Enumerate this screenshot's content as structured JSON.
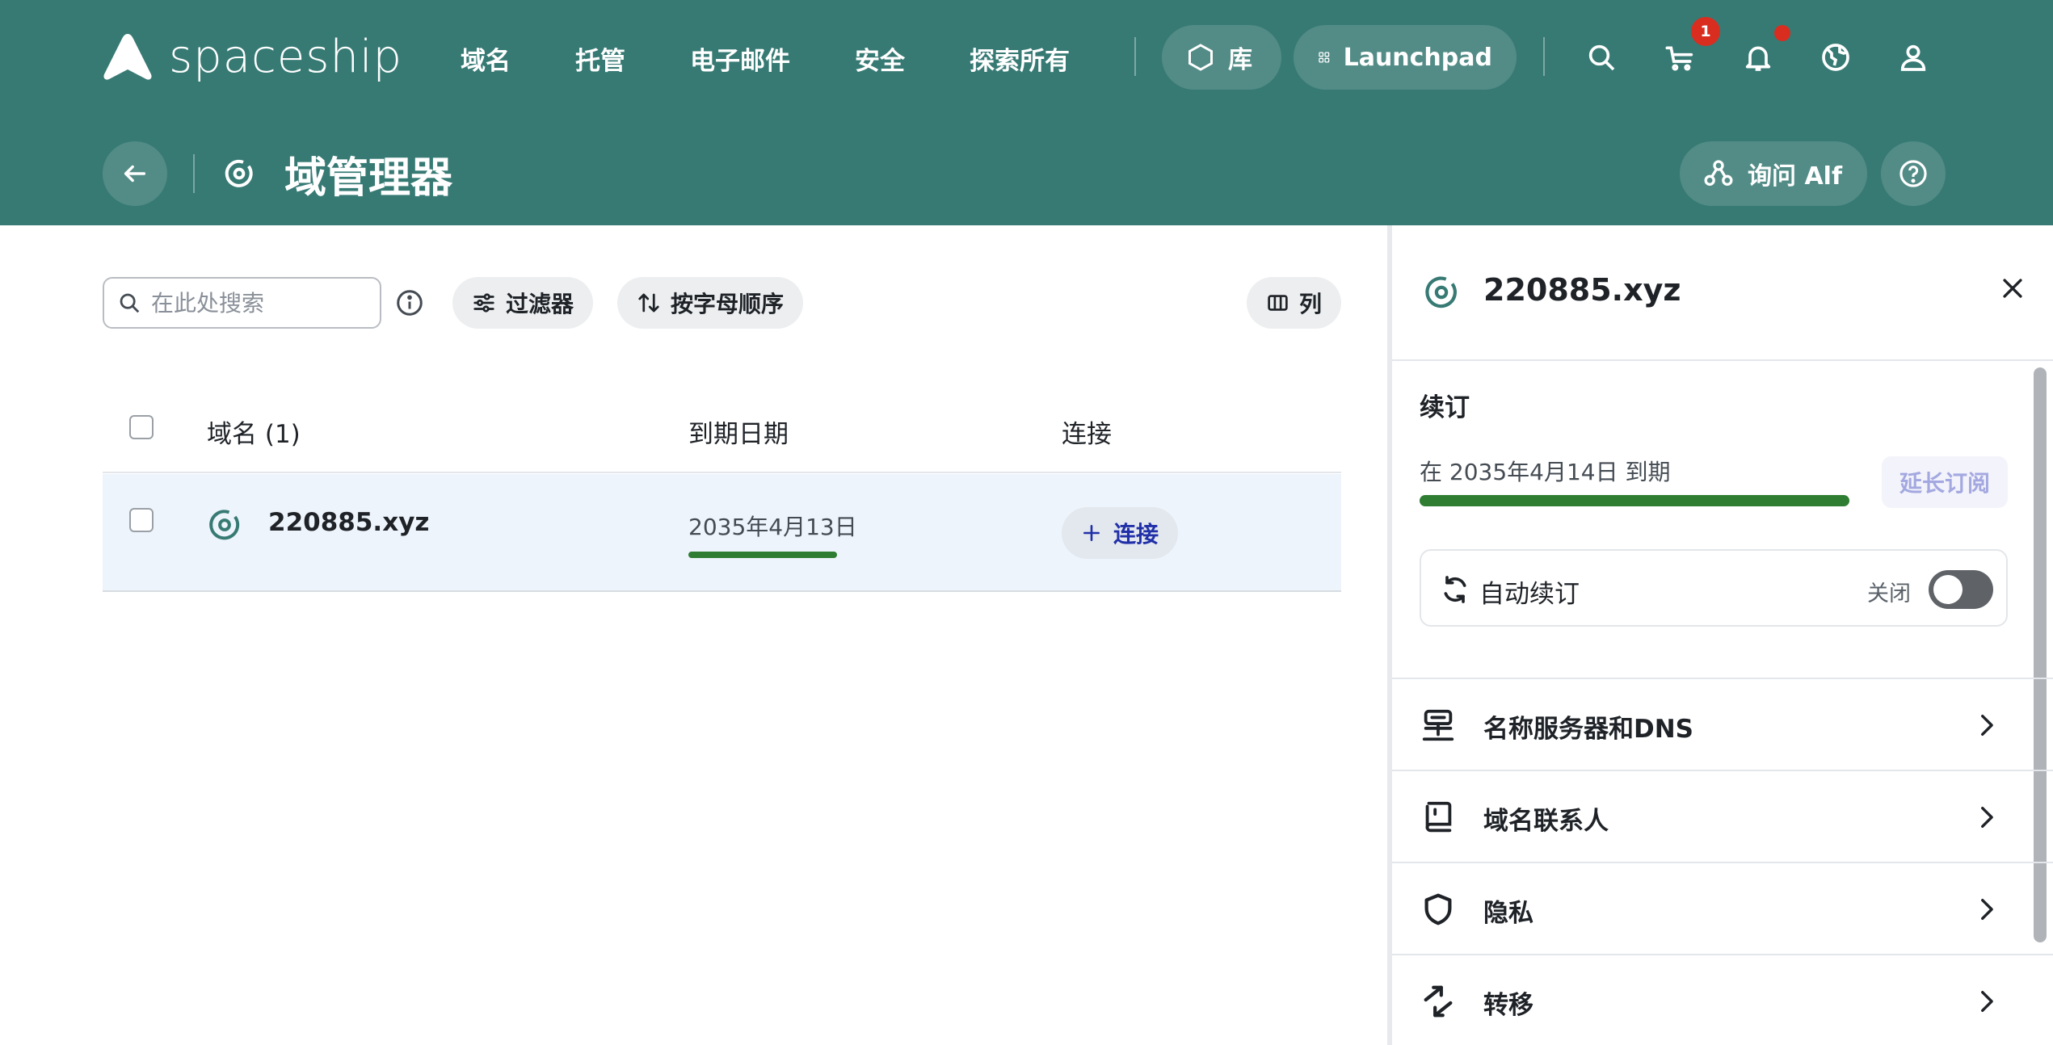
{
  "header": {
    "brand": "spaceship",
    "nav": [
      "域名",
      "托管",
      "电子邮件",
      "安全",
      "探索所有"
    ],
    "library_label": "库",
    "launchpad_label": "Launchpad",
    "cart_count": "1",
    "page_title": "域管理器",
    "ask_alf_label": "询问 Alf",
    "icons": [
      "search-icon",
      "cart-icon",
      "bell-icon",
      "globe-icon",
      "user-icon"
    ]
  },
  "toolbar": {
    "search_placeholder": "在此处搜索",
    "filter_label": "过滤器",
    "sort_label": "按字母顺序",
    "columns_label": "列"
  },
  "table": {
    "columns": [
      "域名 (1)",
      "到期日期",
      "连接"
    ],
    "rows": [
      {
        "domain": "220885.xyz",
        "expiry": "2035年4月13日",
        "connect_label": "连接"
      }
    ]
  },
  "drawer": {
    "domain": "220885.xyz",
    "renewal_title": "续订",
    "expire_text": "在 2035年4月14日 到期",
    "extend_label": "延长订阅",
    "auto_renew_label": "自动续订",
    "auto_renew_state": "关闭",
    "auto_renew_on": false,
    "menu": [
      "名称服务器和DNS",
      "域名联系人",
      "隐私",
      "转移"
    ]
  },
  "colors": {
    "header_bg": "#377a74",
    "accent_green": "#2e7d32",
    "link_blue": "#2130a8",
    "badge_red": "#d92d20",
    "row_highlight": "#eef4fc"
  }
}
